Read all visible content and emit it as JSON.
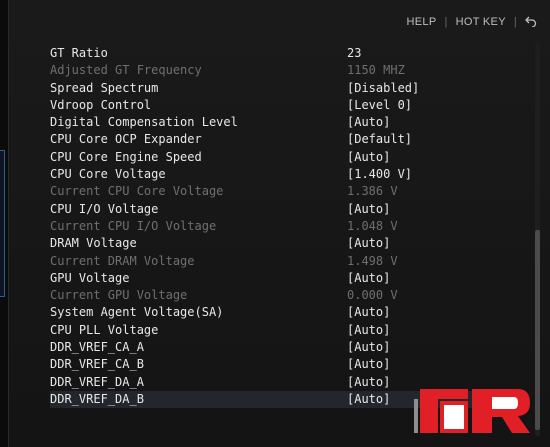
{
  "header": {
    "help_label": "HELP",
    "separator": "|",
    "hotkey_label": "HOT KEY",
    "back_icon": "back-arrow-icon"
  },
  "settings": [
    {
      "label": "GT Ratio",
      "value": "23",
      "state": "active"
    },
    {
      "label": "Adjusted GT Frequency",
      "value": "1150 MHZ",
      "state": "readonly"
    },
    {
      "label": "Spread Spectrum",
      "value": "[Disabled]",
      "state": "active"
    },
    {
      "label": "Vdroop Control",
      "value": "[Level 0]",
      "state": "active"
    },
    {
      "label": "Digital Compensation Level",
      "value": "[Auto]",
      "state": "active"
    },
    {
      "label": "CPU Core OCP Expander",
      "value": "[Default]",
      "state": "active"
    },
    {
      "label": "CPU Core Engine Speed",
      "value": "[Auto]",
      "state": "active"
    },
    {
      "label": "CPU Core Voltage",
      "value": "[1.400 V]",
      "state": "active"
    },
    {
      "label": "Current CPU Core Voltage",
      "value": "1.386 V",
      "state": "readonly"
    },
    {
      "label": "CPU I/O Voltage",
      "value": "[Auto]",
      "state": "active"
    },
    {
      "label": "Current CPU I/O Voltage",
      "value": "1.048 V",
      "state": "readonly"
    },
    {
      "label": "DRAM Voltage",
      "value": "[Auto]",
      "state": "active"
    },
    {
      "label": "Current DRAM Voltage",
      "value": "1.498 V",
      "state": "readonly"
    },
    {
      "label": "GPU Voltage",
      "value": "[Auto]",
      "state": "active"
    },
    {
      "label": "Current GPU Voltage",
      "value": "0.000 V",
      "state": "readonly"
    },
    {
      "label": "System Agent Voltage(SA)",
      "value": "[Auto]",
      "state": "active"
    },
    {
      "label": "CPU PLL Voltage",
      "value": "[Auto]",
      "state": "active"
    },
    {
      "label": "DDR_VREF_CA_A",
      "value": "[Auto]",
      "state": "active"
    },
    {
      "label": "DDR_VREF_CA_B",
      "value": "[Auto]",
      "state": "active"
    },
    {
      "label": "DDR_VREF_DA_A",
      "value": "[Auto]",
      "state": "active"
    },
    {
      "label": "DDR_VREF_DA_B",
      "value": "[Auto]",
      "state": "selected"
    }
  ],
  "logo": {
    "icon": "legit-reviews-logo-icon",
    "colors": {
      "red": "#e11f26",
      "white": "#ffffff",
      "gray": "#8e8e8e"
    }
  }
}
